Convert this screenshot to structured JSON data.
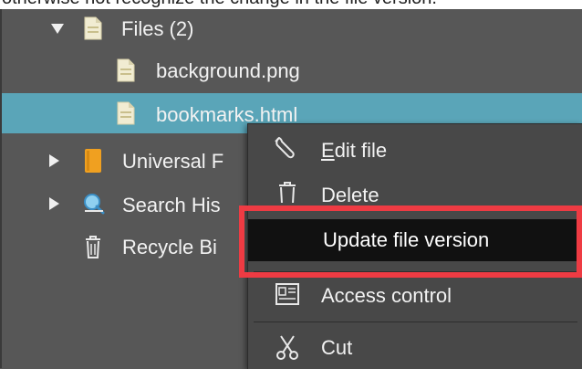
{
  "caption": {
    "text": "otherwise not recognize the change in the file version."
  },
  "tree": {
    "files_folder": {
      "label": "Files (2)",
      "expanded": true
    },
    "items": [
      {
        "label": "background.png"
      },
      {
        "label": "bookmarks.html",
        "selected": true
      }
    ],
    "universal": {
      "label": "Universal F"
    },
    "search": {
      "label": "Search His"
    },
    "recycle": {
      "label": "Recycle Bi"
    }
  },
  "context_menu": {
    "edit": {
      "label": "Edit file",
      "accel": "E",
      "rest": "dit file",
      "icon": "wrench-icon"
    },
    "delete": {
      "label": "Delete",
      "icon": "trash-icon"
    },
    "update": {
      "label": "Update file version",
      "highlighted": true
    },
    "access": {
      "label": "Access control",
      "icon": "access-card-icon"
    },
    "cut": {
      "label": "Cut",
      "icon": "scissors-icon"
    }
  },
  "colors": {
    "background": "#575757",
    "selection": "#5aa5b8",
    "menu_bg": "#484848",
    "menu_highlight": "#111111",
    "annotation_red": "#ee3b43"
  }
}
